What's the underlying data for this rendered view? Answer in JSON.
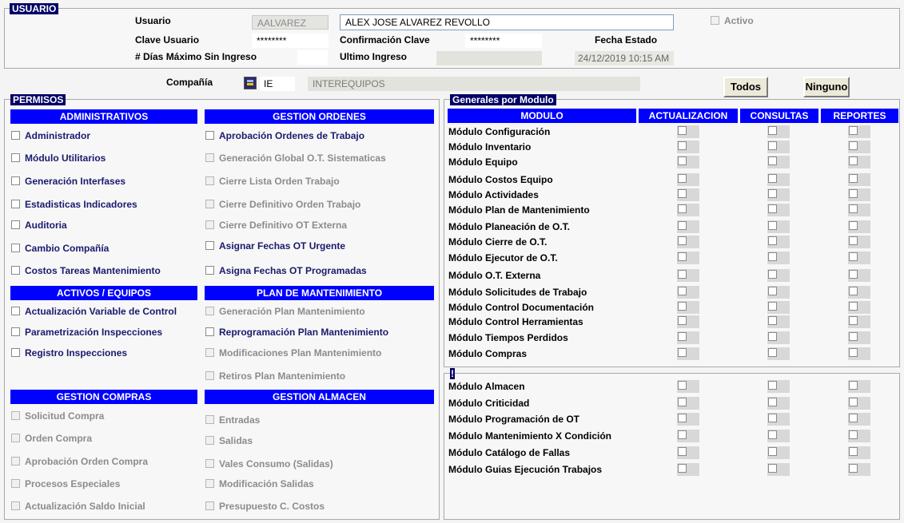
{
  "usuario": {
    "title": "USUARIO",
    "usuario_label": "Usuario",
    "usuario_code": "AALVAREZ",
    "usuario_name": "ALEX JOSE ALVAREZ REVOLLO",
    "activo_label": "Activo",
    "clave_label": "Clave Usuario",
    "clave_value": "********",
    "confirmacion_label": "Confirmación Clave",
    "confirmacion_value": "********",
    "fecha_estado_label": "Fecha Estado",
    "dias_label": "# Días Máximo Sin Ingreso",
    "dias_value": "",
    "ultimo_label": "Ultimo Ingreso",
    "ultimo_value": "",
    "fecha_estado_value": "24/12/2019 10:15 AM"
  },
  "compania": {
    "label": "Compañía",
    "code": "IE",
    "name": "INTEREQUIPOS"
  },
  "buttons": {
    "todos": "Todos",
    "ninguno": "Ninguno"
  },
  "permisos": {
    "title": "PERMISOS",
    "administrativos": {
      "header": "ADMINISTRATIVOS",
      "items": [
        "Administrador",
        "Módulo Utilitarios",
        "Generación Interfases",
        "Estadisticas  Indicadores",
        "Auditoria",
        "Cambio Compañía",
        "Costos Tareas Mantenimiento"
      ]
    },
    "gestion_ordenes": {
      "header": "GESTION ORDENES",
      "items": [
        "Aprobación Ordenes de Trabajo",
        "Generación Global O.T. Sistematicas",
        "Cierre Lista Orden Trabajo",
        "Cierre Definitivo Orden Trabajo",
        "Cierre Definitivo OT Externa",
        "Asignar Fechas OT Urgente",
        "Asigna Fechas OT Programadas"
      ]
    },
    "activos": {
      "header": "ACTIVOS / EQUIPOS",
      "items": [
        "Actualización Variable de Control",
        "Parametrización Inspecciones",
        "Registro Inspecciones"
      ]
    },
    "plan": {
      "header": "PLAN DE MANTENIMIENTO",
      "items": [
        "Generación  Plan Mantenimiento",
        "Reprogramación Plan Mantenimiento",
        "Modificaciones Plan Mantenimiento",
        "Retiros Plan Mantenimiento"
      ]
    },
    "compras": {
      "header": "GESTION COMPRAS",
      "items": [
        "Solicitud Compra",
        "Orden Compra",
        "Aprobación Orden Compra",
        "Procesos Especiales",
        "Actualización Saldo Inicial"
      ]
    },
    "almacen": {
      "header": "GESTION ALMACEN",
      "items": [
        "Entradas",
        "Salidas",
        "Vales Consumo (Salidas)",
        "Modificación Salidas",
        "Presupuesto C. Costos"
      ]
    }
  },
  "generales": {
    "title": "Generales por Modulo",
    "columns": [
      "MODULO",
      "ACTUALIZACION",
      "CONSULTAS",
      "REPORTES"
    ],
    "modules": [
      "Módulo Configuración",
      "Módulo Inventario",
      "Módulo Equipo",
      "Módulo Costos Equipo",
      "Módulo Actividades",
      "Módulo Plan de Mantenimiento",
      "Módulo Planeación de O.T.",
      "Módulo Cierre de O.T.",
      "Módulo Ejecutor de O.T.",
      "Módulo  O.T. Externa",
      "Módulo Solicitudes de Trabajo",
      "Módulo Control Documentación",
      "Módulo Control Herramientas",
      "Módulo Tiempos Perdidos",
      "Módulo Compras"
    ],
    "modules2_title": "!",
    "modules2": [
      "Módulo Almacen",
      "Módulo Criticidad",
      "Módulo Programación de OT",
      "Módulo Mantenimiento X Condición",
      "Módulo Catálogo de Fallas",
      "Módulo Guias Ejecución Trabajos"
    ]
  }
}
